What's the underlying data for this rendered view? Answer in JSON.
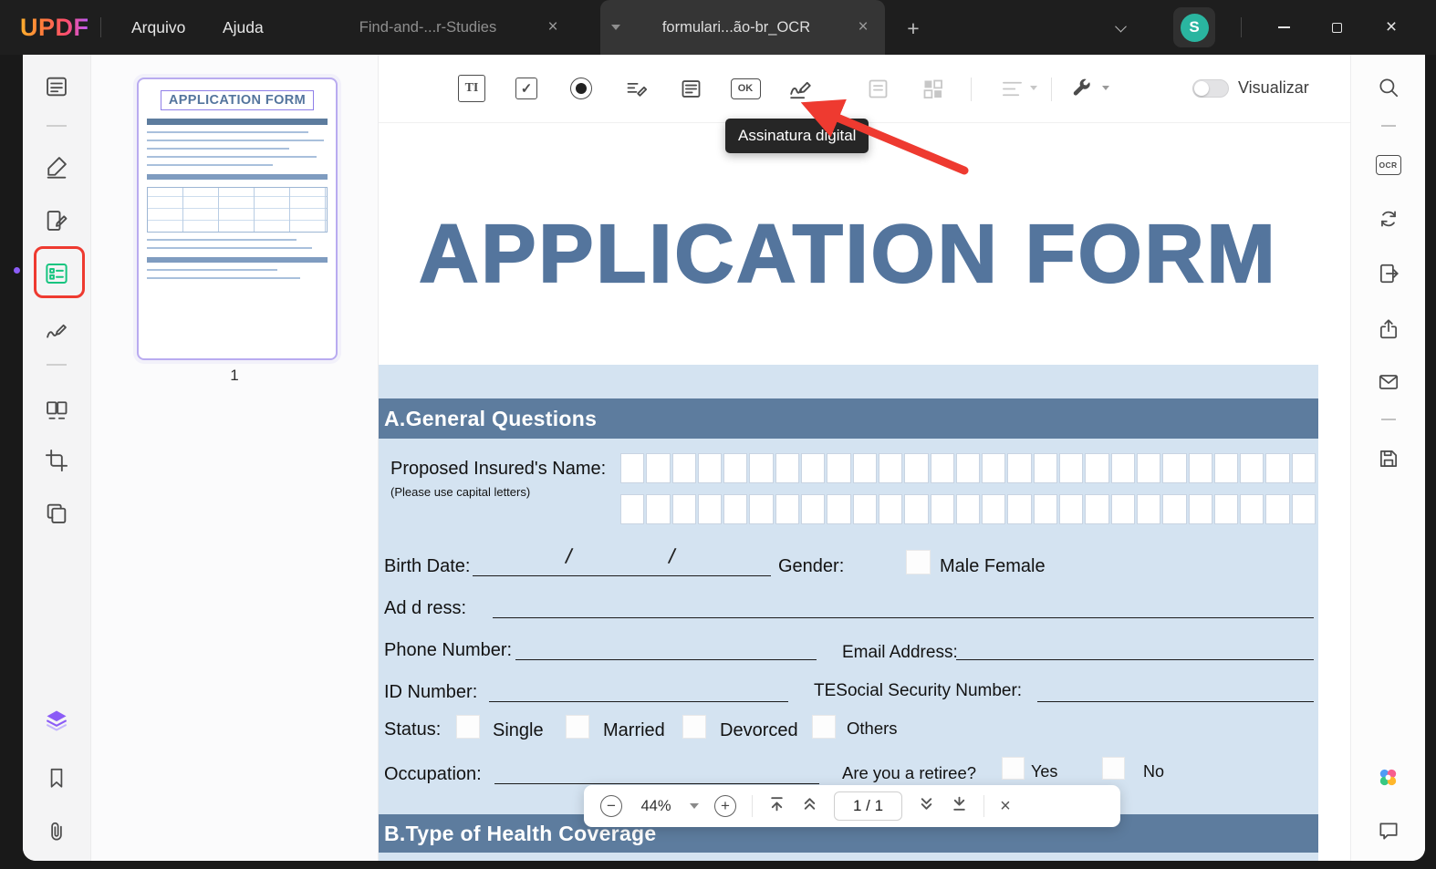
{
  "titlebar": {
    "logo": "UPDF",
    "menus": [
      {
        "label": "Arquivo"
      },
      {
        "label": "Ajuda"
      }
    ],
    "tabs": [
      {
        "label": "Find-and-...r-Studies"
      },
      {
        "label": "formulari...ão-br_OCR"
      }
    ],
    "avatar_initial": "S"
  },
  "main_toolbar": {
    "text_field_glyph": "TI",
    "ok_glyph": "OK",
    "signature_tooltip": "Assinatura digital",
    "preview_toggle_label": "Visualizar"
  },
  "thumbnail_panel": {
    "thumb_title": "APPLICATION FORM",
    "page_number": "1"
  },
  "document": {
    "title": "APPLICATION FORM",
    "sections": {
      "a": "A.General Questions",
      "b": "B.Type of Health Coverage"
    },
    "name": {
      "label": "Proposed Insured's Name:",
      "hint": "(Please use capital letters)",
      "boxes_per_row": 27
    },
    "birth": {
      "label": "Birth Date:"
    },
    "gender": {
      "label": "Gender:",
      "options": "Male Female"
    },
    "address": {
      "label": "Ad d ress:"
    },
    "phone": {
      "label": "Phone Number:"
    },
    "email": {
      "label": "Email Address:"
    },
    "id": {
      "label": "ID Number:"
    },
    "ssn": {
      "label": "TESocial Security Number:"
    },
    "status": {
      "label": "Status:",
      "options": [
        "Single",
        "Married",
        "Devorced",
        "Others"
      ]
    },
    "occupation": {
      "label": "Occupation:"
    },
    "retiree": {
      "label": "Are you a retiree?",
      "yes": "Yes",
      "no": "No"
    }
  },
  "zoom_toolbar": {
    "zoom_level": "44%",
    "page_indicator": "1 / 1"
  },
  "glyphs": {
    "close": "×",
    "plus": "+",
    "minus": "−",
    "check": "✓",
    "ocr": "OCR",
    "slash": "/"
  },
  "colors": {
    "accent_green": "#16c47f",
    "annotation_red": "#ee3a30",
    "selection_purple": "#8b5cf6",
    "doc_blue": "#54759d",
    "section_bar": "#5d7c9e",
    "form_bg": "#d4e3f1"
  }
}
